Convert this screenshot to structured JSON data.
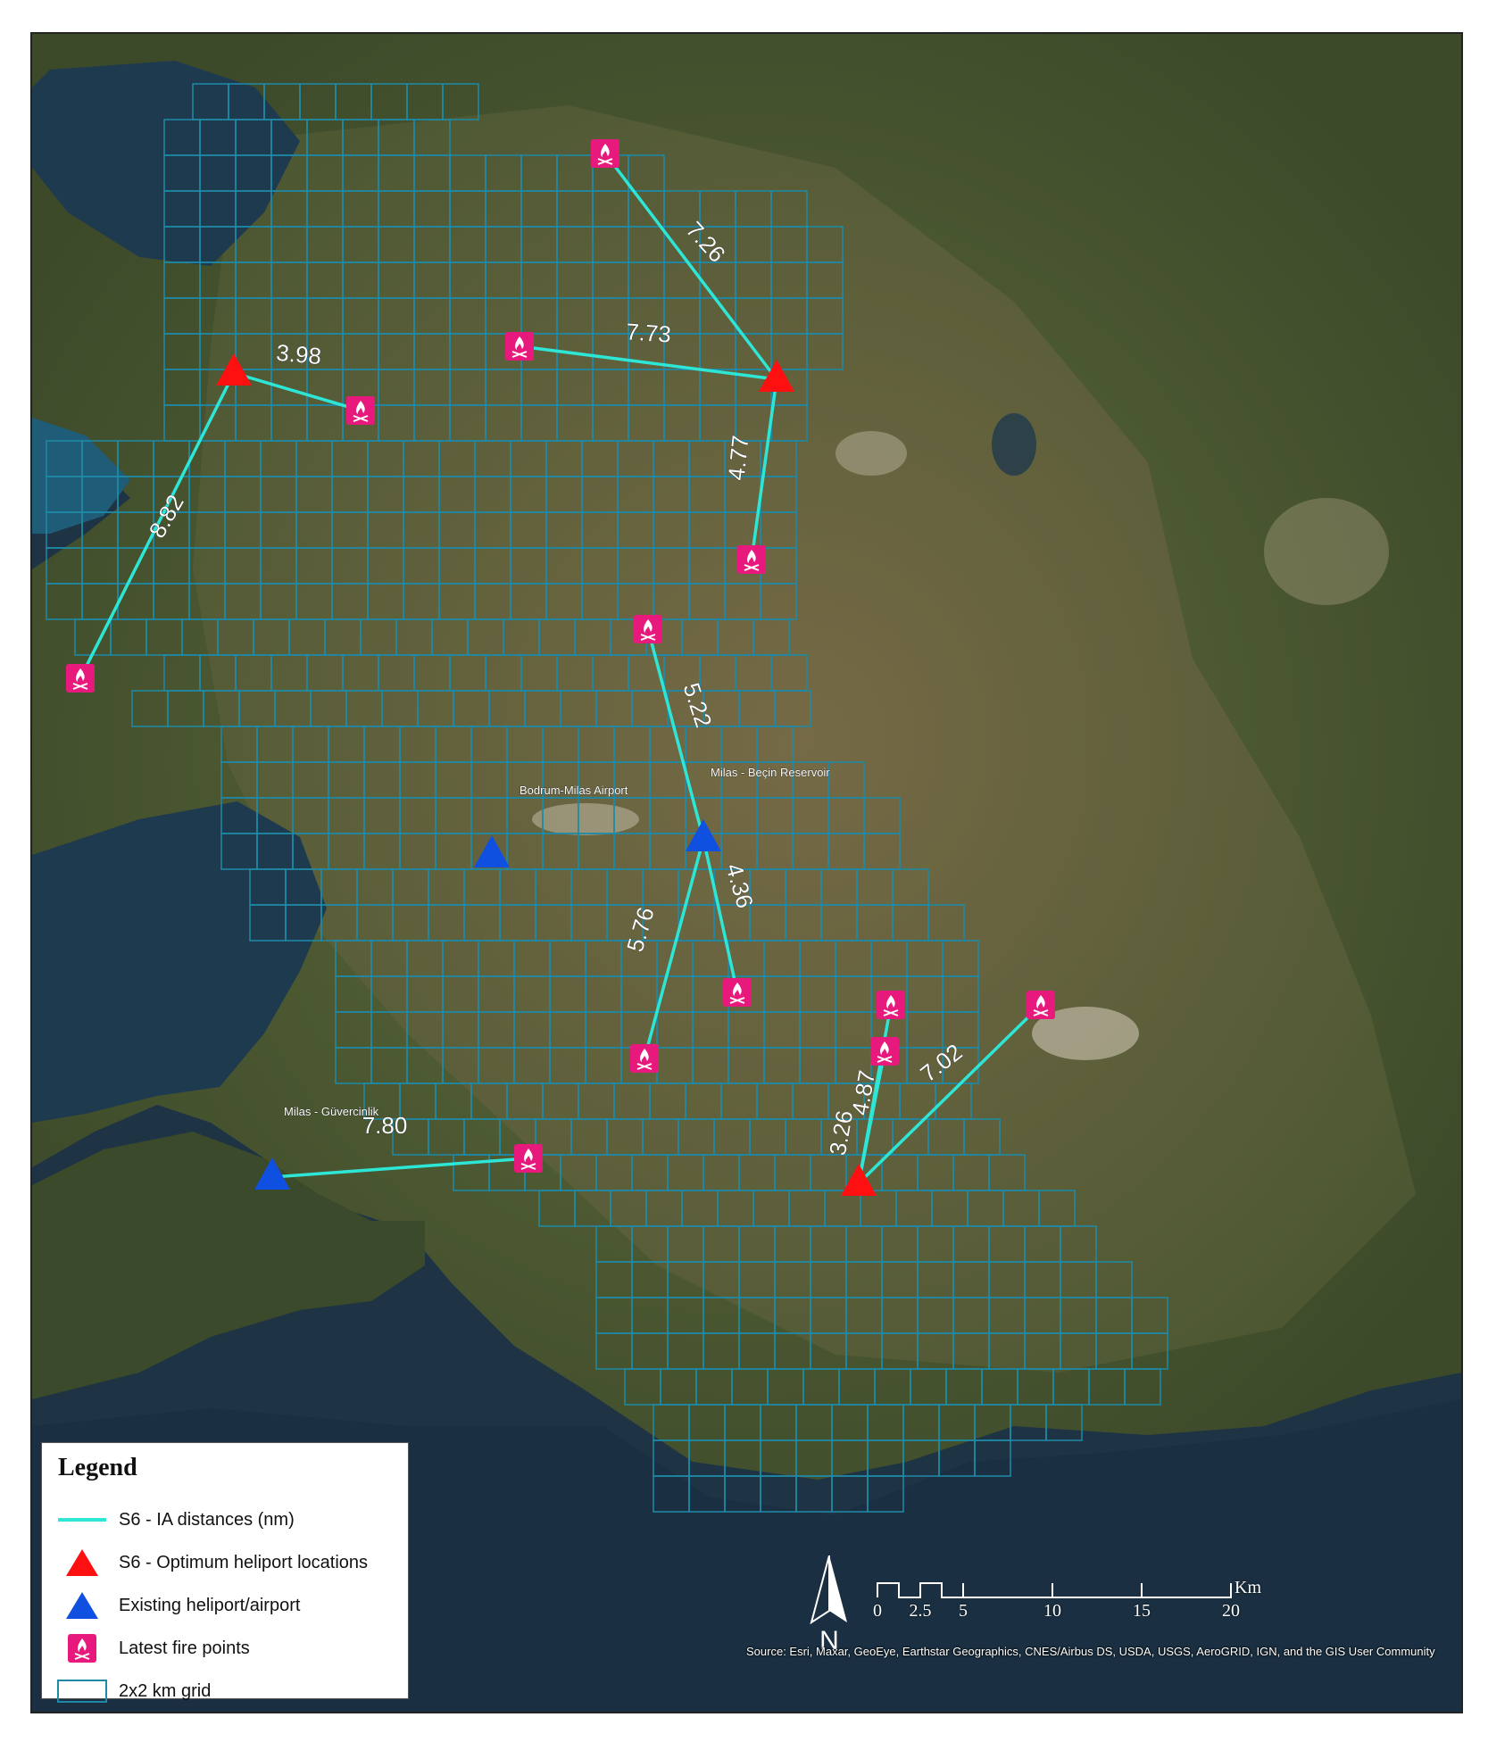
{
  "legend": {
    "title": "Legend",
    "items": [
      {
        "label": "S6 - IA distances (nm)",
        "symbol": "line",
        "color": "#2ee6d6"
      },
      {
        "label": "S6 - Optimum heliport locations",
        "symbol": "triangle",
        "color": "#ff1010"
      },
      {
        "label": "Existing heliport/airport",
        "symbol": "triangle",
        "color": "#1050e0"
      },
      {
        "label": "Latest fire points",
        "symbol": "fire-icon",
        "color": "#e8197d"
      },
      {
        "label": "2x2 km grid",
        "symbol": "grid-square",
        "color": "#1f8aa6"
      }
    ]
  },
  "places": [
    {
      "name": "Bodrum-Milas Airport"
    },
    {
      "name": "Milas - Beçin Reservoir"
    },
    {
      "name": "Milas - Güvercinlik"
    }
  ],
  "distances": [
    "3.98",
    "8.82",
    "7.26",
    "7.73",
    "4.77",
    "5.22",
    "5.76",
    "4.36",
    "7.80",
    "3.26",
    "4.87",
    "7.02"
  ],
  "scale_bar": {
    "labels": [
      "0",
      "2.5",
      "5",
      "10",
      "15",
      "20"
    ],
    "unit": "Km"
  },
  "north_label": "N",
  "source": "Source: Esri, Maxar, GeoEye, Earthstar Geographics, CNES/Airbus DS, USDA, USGS, AeroGRID, IGN, and the GIS User Community",
  "colors": {
    "line": "#2ee6d6",
    "optimum": "#ff1010",
    "existing": "#1050e0",
    "fire": "#e8197d",
    "grid": "#1f8aa6"
  }
}
